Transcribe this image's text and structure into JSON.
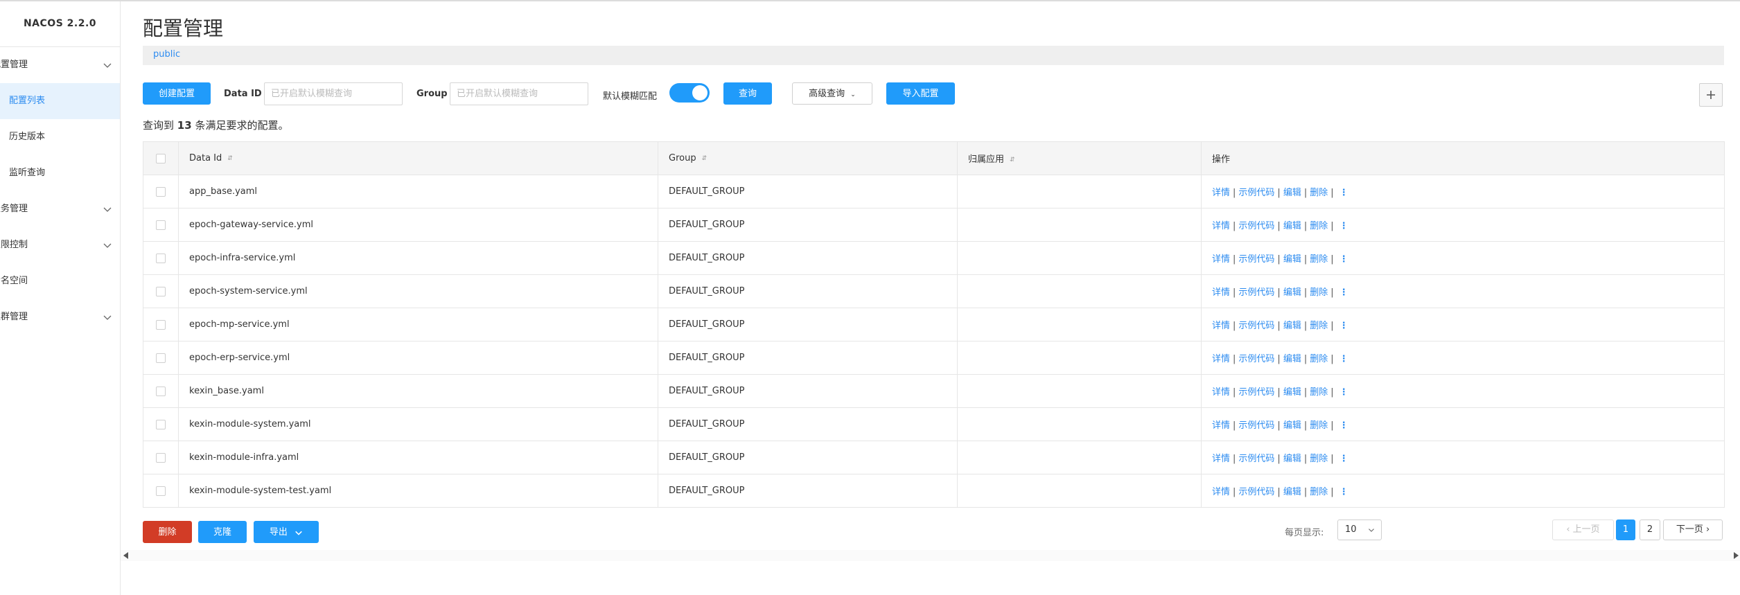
{
  "brand": "NACOS 2.2.0",
  "sidebar": {
    "items": [
      {
        "label": "配置管理",
        "expanded": true,
        "children": [
          "配置列表",
          "历史版本",
          "监听查询"
        ],
        "active_child": "配置列表"
      },
      {
        "label": "服务管理"
      },
      {
        "label": "权限控制"
      },
      {
        "label": "命名空间"
      },
      {
        "label": "集群管理"
      }
    ]
  },
  "page": {
    "title": "配置管理",
    "namespace": "public"
  },
  "toolbar": {
    "create_label": "创建配置",
    "dataid_label": "Data ID",
    "dataid_placeholder": "已开启默认模糊查询",
    "group_label": "Group",
    "group_placeholder": "已开启默认模糊查询",
    "fuzzy_label": "默认模糊匹配",
    "fuzzy_on": true,
    "query_label": "查询",
    "advanced_label": "高级查询",
    "import_label": "导入配置"
  },
  "result": {
    "prefix": "查询到",
    "count": "13",
    "suffix": "条满足要求的配置。"
  },
  "table": {
    "headers": [
      "Data Id",
      "Group",
      "归属应用",
      "操作"
    ],
    "ops": [
      "详情",
      "示例代码",
      "编辑",
      "删除"
    ],
    "rows": [
      {
        "data_id": "app_base.yaml",
        "group": "DEFAULT_GROUP",
        "app": ""
      },
      {
        "data_id": "epoch-gateway-service.yml",
        "group": "DEFAULT_GROUP",
        "app": ""
      },
      {
        "data_id": "epoch-infra-service.yml",
        "group": "DEFAULT_GROUP",
        "app": ""
      },
      {
        "data_id": "epoch-system-service.yml",
        "group": "DEFAULT_GROUP",
        "app": ""
      },
      {
        "data_id": "epoch-mp-service.yml",
        "group": "DEFAULT_GROUP",
        "app": ""
      },
      {
        "data_id": "epoch-erp-service.yml",
        "group": "DEFAULT_GROUP",
        "app": ""
      },
      {
        "data_id": "kexin_base.yaml",
        "group": "DEFAULT_GROUP",
        "app": ""
      },
      {
        "data_id": "kexin-module-system.yaml",
        "group": "DEFAULT_GROUP",
        "app": ""
      },
      {
        "data_id": "kexin-module-infra.yaml",
        "group": "DEFAULT_GROUP",
        "app": ""
      },
      {
        "data_id": "kexin-module-system-test.yaml",
        "group": "DEFAULT_GROUP",
        "app": ""
      }
    ]
  },
  "bottom": {
    "delete_label": "删除",
    "clone_label": "克隆",
    "export_label": "导出"
  },
  "pagination": {
    "page_size_label": "每页显示:",
    "page_size": "10",
    "prev_label": "上一页",
    "next_label": "下一页",
    "pages": [
      "1",
      "2"
    ],
    "current": "1"
  },
  "colors": {
    "primary": "#209bfa",
    "danger": "#d23c26",
    "link": "#2d8cf0",
    "active_bg": "#e6f2fd"
  }
}
